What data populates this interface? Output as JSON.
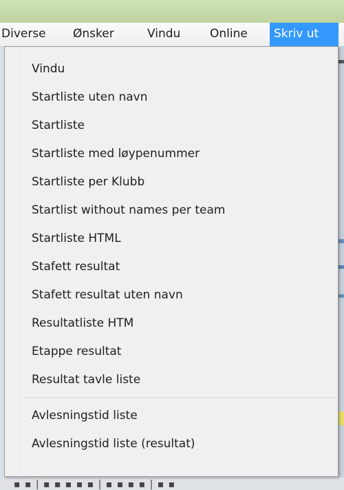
{
  "menubar": {
    "items": [
      {
        "label": "Diverse"
      },
      {
        "label": "Ønsker"
      },
      {
        "label": "Vindu"
      },
      {
        "label": "Online"
      },
      {
        "label": "Skriv ut",
        "active": true
      }
    ]
  },
  "dropdown": {
    "group1": [
      {
        "label": "Vindu"
      },
      {
        "label": "Startliste uten navn"
      },
      {
        "label": "Startliste"
      },
      {
        "label": "Startliste med løypenummer"
      },
      {
        "label": "Startliste per Klubb"
      },
      {
        "label": "Startlist without names per team"
      },
      {
        "label": "Startliste HTML"
      },
      {
        "label": "Stafett resultat"
      },
      {
        "label": "Stafett resultat uten navn"
      },
      {
        "label": "Resultatliste HTM"
      },
      {
        "label": "Etappe resultat"
      },
      {
        "label": "Resultat tavle liste"
      }
    ],
    "group2": [
      {
        "label": "Avlesningstid liste"
      },
      {
        "label": "Avlesningstid liste (resultat)"
      }
    ]
  },
  "colors": {
    "highlight": "#3399ff",
    "menu_bg": "#f0f0f0",
    "top_strip": "#c9dcab"
  }
}
